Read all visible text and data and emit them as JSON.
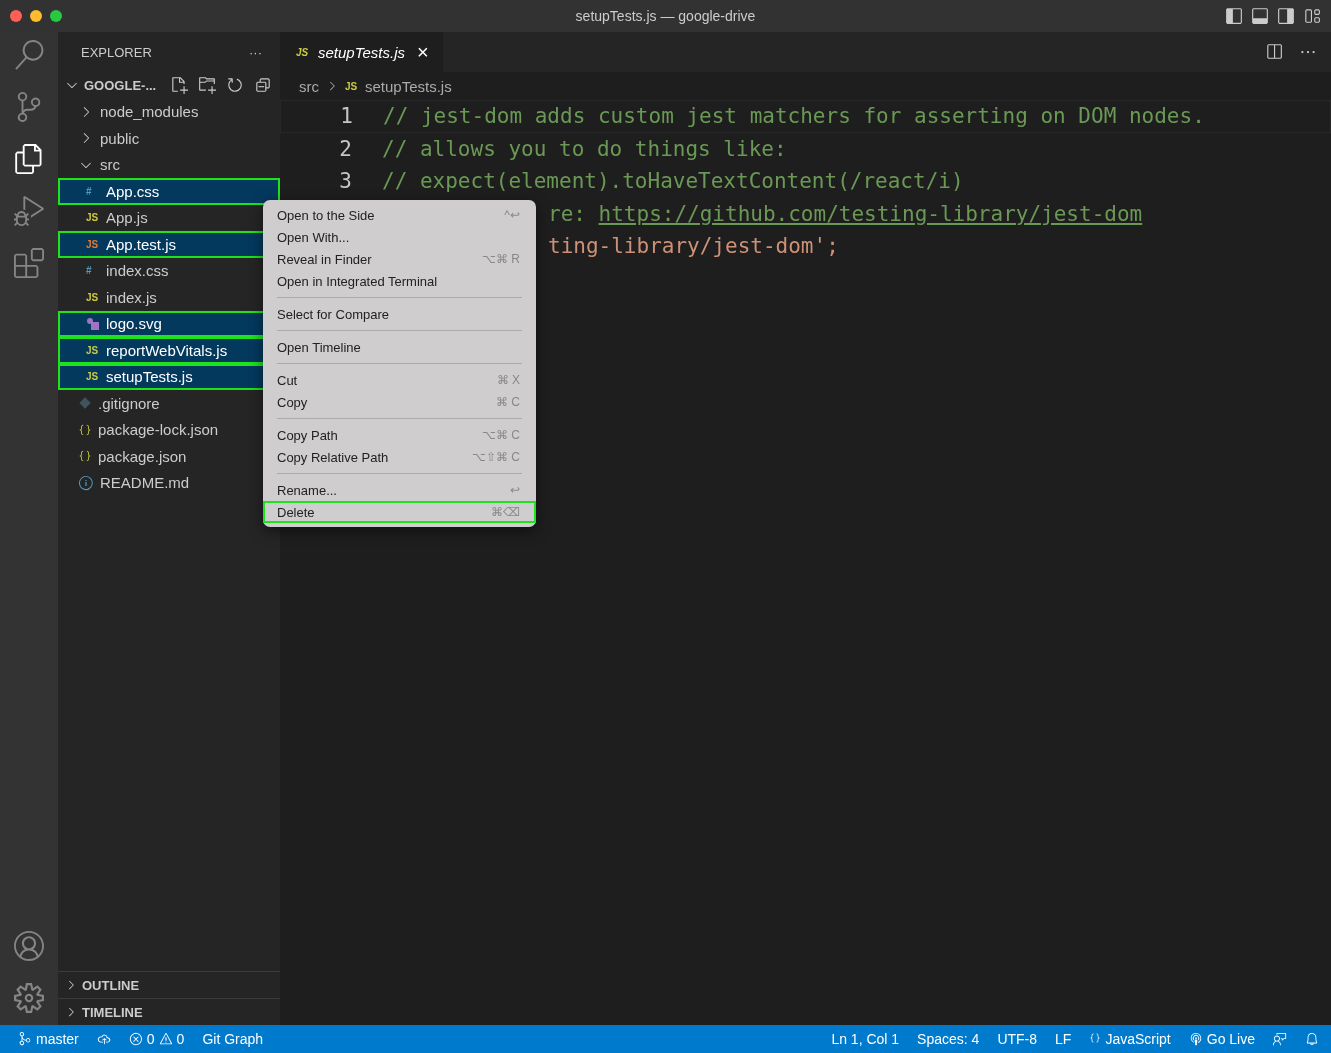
{
  "window": {
    "title": "setupTests.js — google-drive"
  },
  "sidebar": {
    "title": "EXPLORER",
    "more": "···",
    "root": "GOOGLE-...",
    "tree": [
      {
        "label": "node_modules",
        "kind": "folder",
        "expanded": false,
        "selected": false,
        "outlined": false
      },
      {
        "label": "public",
        "kind": "folder",
        "expanded": false,
        "selected": false,
        "outlined": false
      },
      {
        "label": "src",
        "kind": "folder",
        "expanded": true,
        "selected": false,
        "outlined": false,
        "children": [
          {
            "label": "App.css",
            "kind": "css",
            "badge": "#",
            "selected": true,
            "outlined": true
          },
          {
            "label": "App.js",
            "kind": "js",
            "badge": "JS",
            "selected": false,
            "outlined": false
          },
          {
            "label": "App.test.js",
            "kind": "test",
            "badge": "JS",
            "selected": true,
            "outlined": true
          },
          {
            "label": "index.css",
            "kind": "css",
            "badge": "#",
            "selected": false,
            "outlined": false
          },
          {
            "label": "index.js",
            "kind": "js",
            "badge": "JS",
            "selected": false,
            "outlined": false
          },
          {
            "label": "logo.svg",
            "kind": "svg",
            "selected": true,
            "outlined": true
          },
          {
            "label": "reportWebVitals.js",
            "kind": "js",
            "badge": "JS",
            "selected": true,
            "outlined": true
          },
          {
            "label": "setupTests.js",
            "kind": "js",
            "badge": "JS",
            "selected": true,
            "outlined": true
          }
        ]
      },
      {
        "label": ".gitignore",
        "kind": "git",
        "selected": false,
        "outlined": false
      },
      {
        "label": "package-lock.json",
        "kind": "json",
        "selected": false,
        "outlined": false
      },
      {
        "label": "package.json",
        "kind": "json",
        "selected": false,
        "outlined": false
      },
      {
        "label": "README.md",
        "kind": "info",
        "selected": false,
        "outlined": false
      }
    ],
    "panels": [
      "OUTLINE",
      "TIMELINE"
    ]
  },
  "tab": {
    "label": "setupTests.js",
    "badge": "JS",
    "close": "×"
  },
  "breadcrumb": {
    "folder": "src",
    "badge": "JS",
    "file": "setupTests.js"
  },
  "code": [
    {
      "number": "1",
      "text": "// jest-dom adds custom jest matchers for asserting on DOM nodes.",
      "kind": "comment"
    },
    {
      "number": "2",
      "text": "// allows you to do things like:",
      "kind": "comment"
    },
    {
      "number": "3",
      "text": "// expect(element).toHaveTextContent(/react/i)",
      "kind": "comment"
    },
    {
      "text": "re: ",
      "link": "https://github.com/testing-library/jest-dom",
      "kind": "hidden-comment"
    },
    {
      "text": "ting-library/jest-dom';",
      "kind": "hidden-string"
    }
  ],
  "context_menu": {
    "groups": [
      [
        {
          "label": "Open to the Side",
          "shortcut": "^↩",
          "outlined": false
        },
        {
          "label": "Open With...",
          "outlined": false
        },
        {
          "label": "Reveal in Finder",
          "shortcut": "⌥⌘ R",
          "outlined": false
        },
        {
          "label": "Open in Integrated Terminal",
          "outlined": false
        }
      ],
      [
        {
          "label": "Select for Compare",
          "outlined": false
        }
      ],
      [
        {
          "label": "Open Timeline",
          "outlined": false
        }
      ],
      [
        {
          "label": "Cut",
          "shortcut": "⌘ X",
          "outlined": false
        },
        {
          "label": "Copy",
          "shortcut": "⌘ C",
          "outlined": false
        }
      ],
      [
        {
          "label": "Copy Path",
          "shortcut": "⌥⌘ C",
          "outlined": false
        },
        {
          "label": "Copy Relative Path",
          "shortcut": "⌥⇧⌘ C",
          "outlined": false
        }
      ],
      [
        {
          "label": "Rename...",
          "shortcut": "↩",
          "outlined": false
        },
        {
          "label": "Delete",
          "shortcut": "⌘⌫",
          "outlined": true
        }
      ]
    ]
  },
  "status_bar": {
    "branch": "master",
    "errors": "0",
    "warnings": "0",
    "git_graph": "Git Graph",
    "right": [
      "Ln 1, Col 1",
      "Spaces: 4",
      "UTF-8",
      "LF",
      "JavaScript",
      "Go Live"
    ]
  }
}
